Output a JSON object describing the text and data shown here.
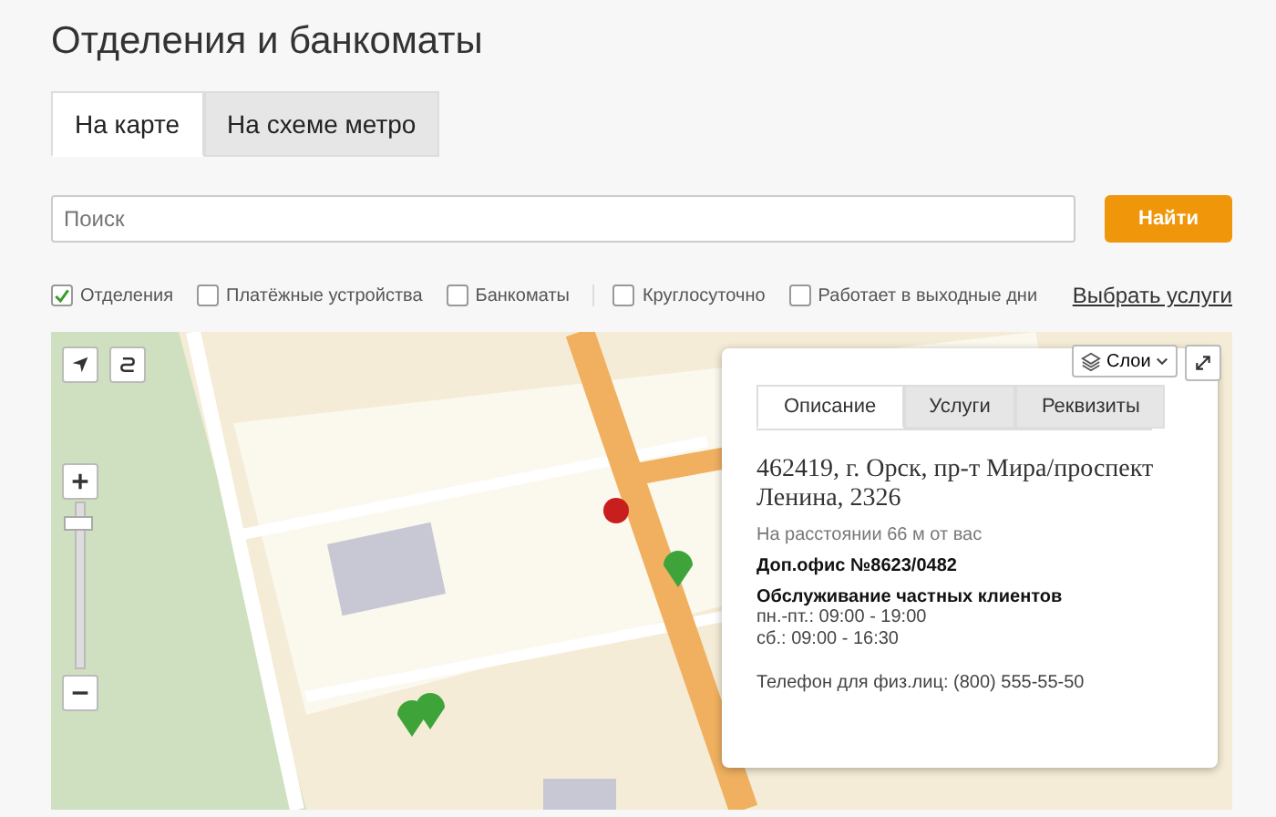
{
  "title": "Отделения и банкоматы",
  "tabs": [
    {
      "label": "На карте",
      "selected": true
    },
    {
      "label": "На схеме метро",
      "selected": false
    }
  ],
  "search": {
    "placeholder": "Поиск",
    "button": "Найти"
  },
  "filters": [
    {
      "label": "Отделения",
      "checked": true
    },
    {
      "label": "Платёжные устройства",
      "checked": false
    },
    {
      "label": "Банкоматы",
      "checked": false
    },
    {
      "label": "Круглосуточно",
      "checked": false
    },
    {
      "label": "Работает в выходные дни",
      "checked": false
    }
  ],
  "services_link": "Выбрать услуги",
  "map": {
    "zoom": {
      "level": 0.9
    },
    "layers_button": "Слои",
    "popup": {
      "tabs": [
        {
          "label": "Описание",
          "selected": true
        },
        {
          "label": "Услуги",
          "selected": false
        },
        {
          "label": "Реквизиты",
          "selected": false
        }
      ],
      "address": "462419, г. Орск, пр-т Мира/проспект Ленина, 2326",
      "distance": "На расстоянии 66 м от вас",
      "office": "Доп.офис №8623/0482",
      "service": "Обслуживание частных клиентов",
      "hours": [
        "пн.-пт.: 09:00 - 19:00",
        "сб.: 09:00 - 16:30"
      ],
      "phone": "Телефон для физ.лиц: (800) 555-55-50"
    }
  }
}
